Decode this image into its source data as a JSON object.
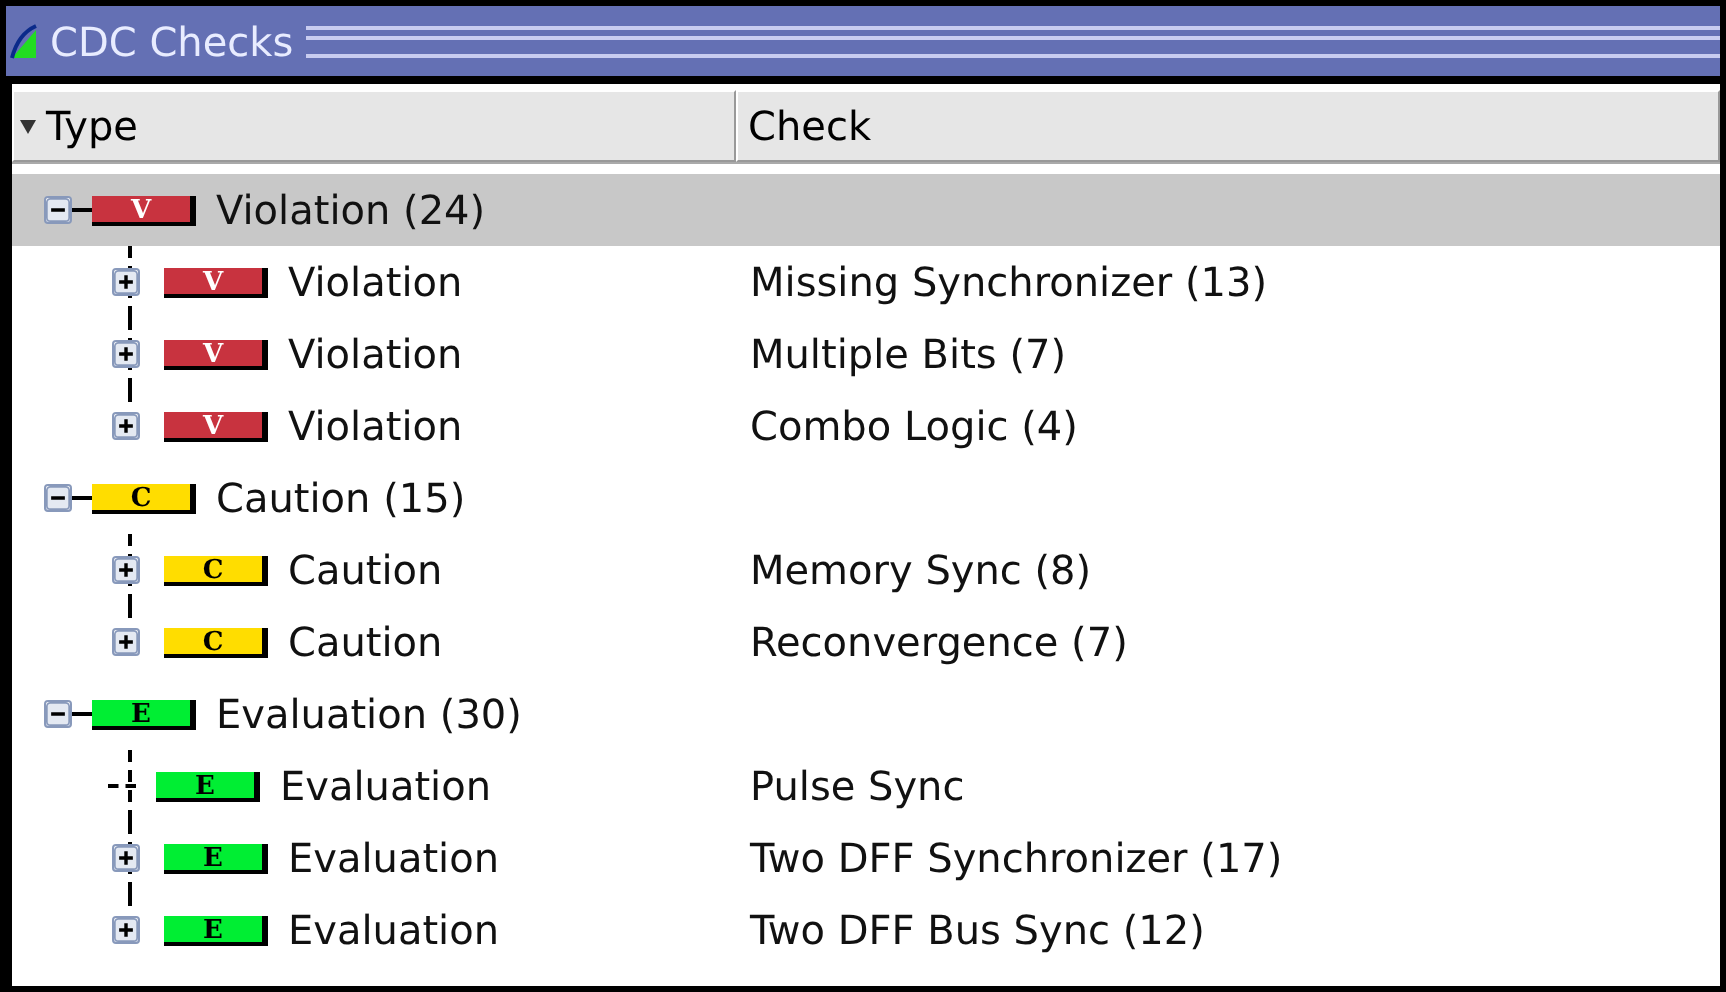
{
  "window": {
    "title": "CDC Checks"
  },
  "columns": [
    {
      "label": "Type"
    },
    {
      "label": "Check"
    }
  ],
  "groups": [
    {
      "badge": "V",
      "color": "#c8333f",
      "label": "Violation (24)",
      "expanded": true,
      "selected": true,
      "children": [
        {
          "badge": "V",
          "label": "Violation",
          "check": "Missing Synchronizer (13)",
          "expandable": true
        },
        {
          "badge": "V",
          "label": "Violation",
          "check": "Multiple Bits (7)",
          "expandable": true
        },
        {
          "badge": "V",
          "label": "Violation",
          "check": "Combo Logic (4)",
          "expandable": true
        }
      ]
    },
    {
      "badge": "C",
      "color": "#ffdd00",
      "label": "Caution (15)",
      "expanded": true,
      "selected": false,
      "children": [
        {
          "badge": "C",
          "label": "Caution",
          "check": "Memory Sync (8)",
          "expandable": true
        },
        {
          "badge": "C",
          "label": "Caution",
          "check": "Reconvergence (7)",
          "expandable": true
        }
      ]
    },
    {
      "badge": "E",
      "color": "#00ee33",
      "label": "Evaluation (30)",
      "expanded": true,
      "selected": false,
      "children": [
        {
          "badge": "E",
          "label": "Evaluation",
          "check": "Pulse Sync",
          "expandable": false
        },
        {
          "badge": "E",
          "label": "Evaluation",
          "check": "Two DFF Synchronizer (17)",
          "expandable": true
        },
        {
          "badge": "E",
          "label": "Evaluation",
          "check": "Two DFF Bus Sync (12)",
          "expandable": true
        }
      ]
    }
  ]
}
